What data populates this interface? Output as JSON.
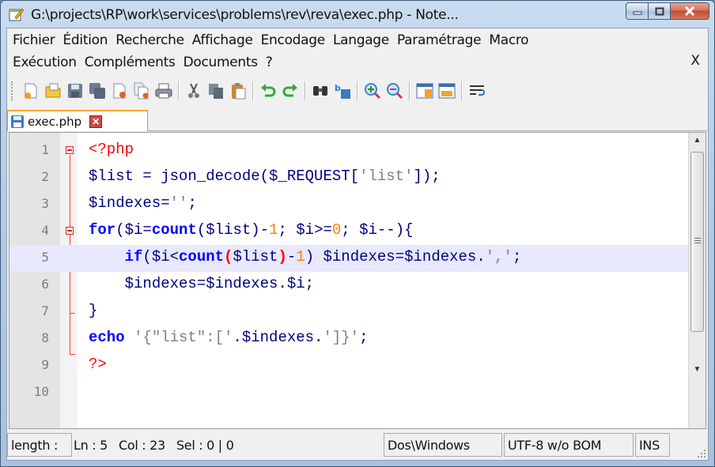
{
  "window": {
    "title": "G:\\projects\\RP\\work\\services\\problems\\rev\\reva\\exec.php - Note...",
    "min_icon": "minimize-icon",
    "max_icon": "maximize-icon",
    "close_icon": "close-icon"
  },
  "menu": {
    "row1": [
      "Fichier",
      "Édition",
      "Recherche",
      "Affichage",
      "Encodage",
      "Langage",
      "Paramétrage",
      "Macro"
    ],
    "row2": [
      "Exécution",
      "Compléments",
      "Documents",
      "?"
    ],
    "close_label": "X"
  },
  "toolbar": {
    "buttons": [
      "new-file-icon",
      "open-file-icon",
      "save-icon",
      "save-all-icon",
      "close-icon",
      "close-all-icon",
      "print-icon",
      "cut-icon",
      "copy-icon",
      "paste-icon",
      "undo-icon",
      "redo-icon",
      "find-icon",
      "replace-icon",
      "zoom-in-icon",
      "zoom-out-icon",
      "sync-vertical-icon",
      "sync-horizontal-icon",
      "word-wrap-icon"
    ]
  },
  "tab": {
    "label": "exec.php",
    "close_label": "✕"
  },
  "editor": {
    "current_line": 5,
    "lines": [
      {
        "n": "1"
      },
      {
        "n": "2"
      },
      {
        "n": "3"
      },
      {
        "n": "4"
      },
      {
        "n": "5"
      },
      {
        "n": "6"
      },
      {
        "n": "7"
      },
      {
        "n": "8"
      },
      {
        "n": "9"
      },
      {
        "n": "10"
      }
    ]
  },
  "status": {
    "length": "length :",
    "ln": "Ln : 5",
    "col": "Col : 23",
    "sel": "Sel : 0 | 0",
    "eol": "Dos\\Windows",
    "encoding": "UTF-8 w/o BOM",
    "mode": "INS"
  },
  "colors": {
    "keyword": "#0000ff",
    "php_tag": "#ff0000",
    "string": "#808080",
    "number": "#ff8000",
    "variable": "#000080",
    "current_line_bg": "#e8e8ff",
    "fold_marker": "#ff0000",
    "tab_accent": "#f7a731"
  }
}
